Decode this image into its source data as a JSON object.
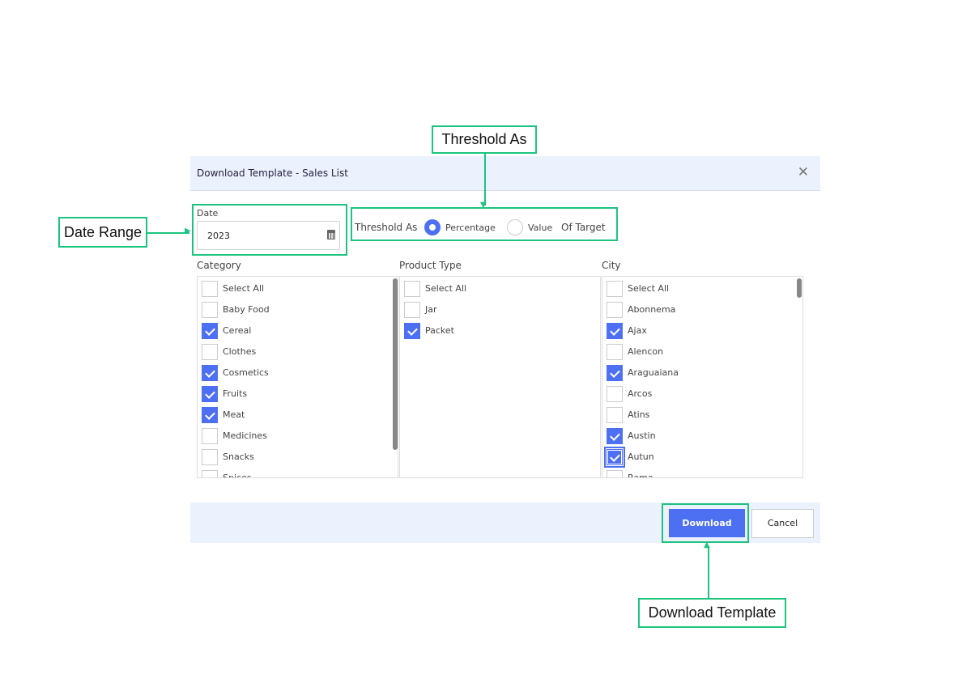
{
  "dialog": {
    "title": "Download Template - Sales List",
    "close_icon": "close-icon"
  },
  "date": {
    "label": "Date",
    "value": "2023",
    "icon": "calendar-icon"
  },
  "threshold": {
    "label": "Threshold As",
    "options": [
      {
        "label": "Percentage",
        "selected": true
      },
      {
        "label": "Value",
        "selected": false
      }
    ],
    "suffix": "Of Target"
  },
  "lists": [
    {
      "label": "Category",
      "items": [
        {
          "label": "Select All",
          "checked": false
        },
        {
          "label": "Baby Food",
          "checked": false
        },
        {
          "label": "Cereal",
          "checked": true
        },
        {
          "label": "Clothes",
          "checked": false
        },
        {
          "label": "Cosmetics",
          "checked": true
        },
        {
          "label": "Fruits",
          "checked": true
        },
        {
          "label": "Meat",
          "checked": true
        },
        {
          "label": "Medicines",
          "checked": false
        },
        {
          "label": "Snacks",
          "checked": false
        },
        {
          "label": "Spices",
          "checked": false
        }
      ]
    },
    {
      "label": "Product Type",
      "items": [
        {
          "label": "Select All",
          "checked": false
        },
        {
          "label": "Jar",
          "checked": false
        },
        {
          "label": "Packet",
          "checked": true
        }
      ]
    },
    {
      "label": "City",
      "items": [
        {
          "label": "Select All",
          "checked": false
        },
        {
          "label": "Abonnema",
          "checked": false
        },
        {
          "label": "Ajax",
          "checked": true
        },
        {
          "label": "Alencon",
          "checked": false
        },
        {
          "label": "Araguaiana",
          "checked": true
        },
        {
          "label": "Arcos",
          "checked": false
        },
        {
          "label": "Atins",
          "checked": false
        },
        {
          "label": "Austin",
          "checked": true
        },
        {
          "label": "Autun",
          "checked": true,
          "focused": true
        },
        {
          "label": "Rama",
          "checked": false
        }
      ]
    }
  ],
  "footer": {
    "download_label": "Download",
    "cancel_label": "Cancel"
  },
  "annotations": {
    "threshold": "Threshold As",
    "date_range": "Date Range",
    "download": "Download Template"
  },
  "colors": {
    "accent": "#4d6ff2",
    "annotation": "#1dc47f",
    "header_bg": "#ebf2fd"
  }
}
